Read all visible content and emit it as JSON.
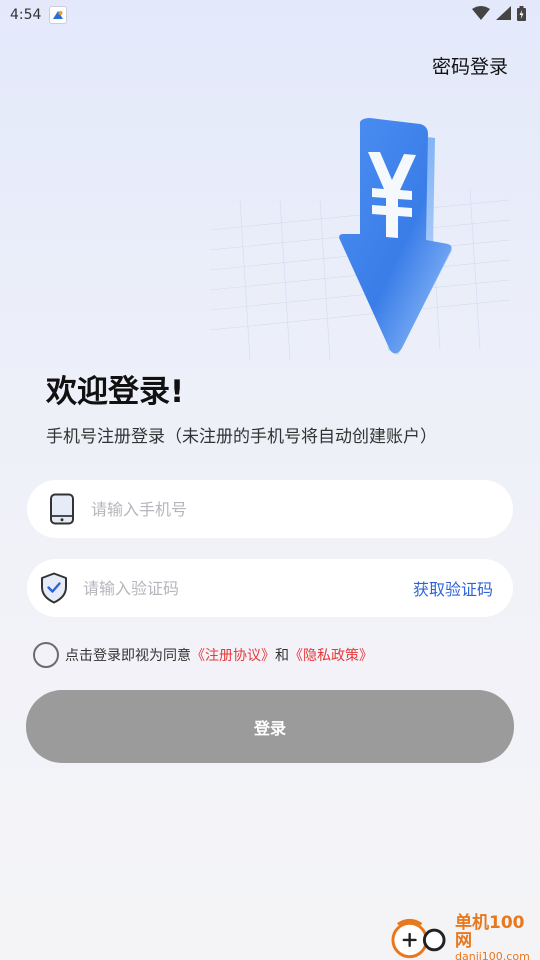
{
  "status_bar": {
    "time": "4:54",
    "app_icon": "app-notification-icon",
    "icons": [
      "wifi-icon",
      "signal-icon",
      "battery-icon"
    ]
  },
  "header": {
    "password_login": "密码登录"
  },
  "hero": {
    "icon": "yen-download-arrow-icon"
  },
  "welcome": {
    "title": "欢迎登录!",
    "subtitle": "手机号注册登录（未注册的手机号将自动创建账户）"
  },
  "form": {
    "phone_placeholder": "请输入手机号",
    "phone_value": "",
    "code_placeholder": "请输入验证码",
    "code_value": "",
    "get_code_label": "获取验证码"
  },
  "agreement": {
    "checked": false,
    "prefix": "点击登录即视为同意",
    "terms_link": "《注册协议》",
    "and": "和",
    "privacy_link": "《隐私政策》"
  },
  "login_button": {
    "label": "登录",
    "color": "#9b9b9b"
  },
  "watermark": {
    "name": "单机100网",
    "url": "danji100.com"
  },
  "colors": {
    "accent": "#2f63d9",
    "link": "#e83a3a"
  }
}
